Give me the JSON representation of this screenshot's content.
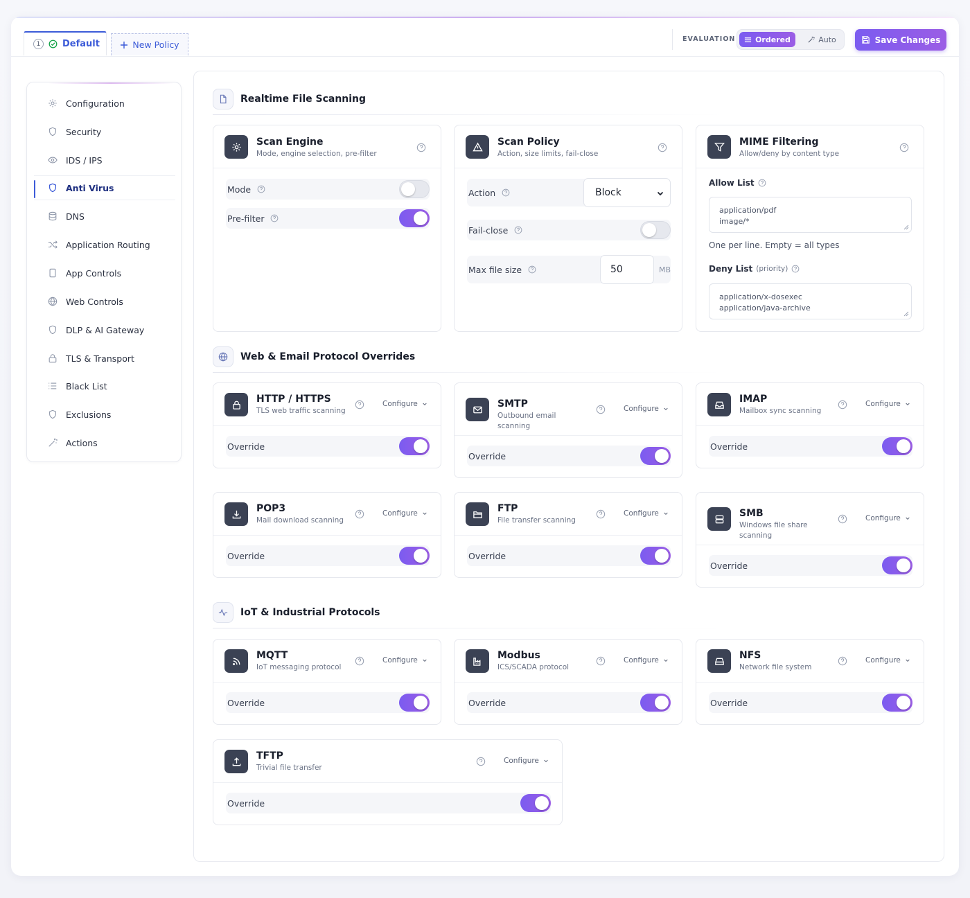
{
  "tabs": [
    {
      "number": "1",
      "label": "Default"
    },
    {
      "label": "New Policy"
    }
  ],
  "evaluation": {
    "label": "EVALUATION",
    "options": [
      "Ordered",
      "Auto"
    ],
    "selected": "Ordered"
  },
  "save_label": "Save Changes",
  "accent_color": "#7b5cf0",
  "sidebar": {
    "active": "Anti Virus",
    "items": [
      {
        "label": "Configuration",
        "icon": "gear-icon"
      },
      {
        "label": "Security",
        "icon": "shield-icon"
      },
      {
        "label": "IDS / IPS",
        "icon": "eye-icon"
      },
      {
        "label": "Anti Virus",
        "icon": "shield-icon"
      },
      {
        "label": "DNS",
        "icon": "database-icon"
      },
      {
        "label": "Application Routing",
        "icon": "shuffle-icon"
      },
      {
        "label": "App Controls",
        "icon": "tablet-icon"
      },
      {
        "label": "Web Controls",
        "icon": "globe-icon"
      },
      {
        "label": "DLP & AI Gateway",
        "icon": "shield-icon"
      },
      {
        "label": "TLS & Transport",
        "icon": "lock-icon"
      },
      {
        "label": "Black List",
        "icon": "list-icon"
      },
      {
        "label": "Exclusions",
        "icon": "shield-icon"
      },
      {
        "label": "Actions",
        "icon": "wand-icon"
      }
    ]
  },
  "sections": {
    "realtime": {
      "title": "Realtime File Scanning",
      "icon": "file-icon"
    },
    "web_email": {
      "title": "Web & Email Protocol Overrides",
      "icon": "globe-icon"
    },
    "iot": {
      "title": "IoT & Industrial Protocols",
      "icon": "activity-icon"
    }
  },
  "scan_engine": {
    "title": "Scan Engine",
    "subtitle": "Mode, engine selection, pre-filter",
    "rows": [
      {
        "label": "Mode",
        "enabled": false
      },
      {
        "label": "Pre-filter",
        "enabled": true
      }
    ]
  },
  "scan_policy": {
    "title": "Scan Policy",
    "subtitle": "Action, size limits, fail-close",
    "action_label": "Action",
    "action_value": "Block",
    "fail_close_label": "Fail-close",
    "fail_close_enabled": false,
    "max_size_label": "Max file size",
    "max_size_value": "50",
    "max_size_unit": "MB"
  },
  "mime": {
    "title": "MIME Filtering",
    "subtitle": "Allow/deny by content type",
    "allow_label": "Allow List",
    "allow_lines": [
      "application/pdf",
      "image/*"
    ],
    "allow_hint": "One per line. Empty = all types",
    "deny_label": "Deny List",
    "deny_note": "(priority)",
    "deny_lines": [
      "application/x-dosexec",
      "application/java-archive"
    ]
  },
  "configure_label": "Configure",
  "override_label": "Override",
  "protocols": [
    {
      "title": "HTTP / HTTPS",
      "subtitle": "TLS web traffic scanning",
      "icon": "lock-icon",
      "override": true
    },
    {
      "title": "SMTP",
      "subtitle": [
        "Outbound email",
        "scanning"
      ],
      "icon": "mail-icon",
      "override": true
    },
    {
      "title": "IMAP",
      "subtitle": "Mailbox sync scanning",
      "icon": "inbox-icon",
      "override": true
    },
    {
      "title": "POP3",
      "subtitle": "Mail download scanning",
      "icon": "download-icon",
      "override": true
    },
    {
      "title": "FTP",
      "subtitle": "File transfer scanning",
      "icon": "folder-icon",
      "override": true
    },
    {
      "title": "SMB",
      "subtitle": [
        "Windows file share",
        "scanning"
      ],
      "icon": "server-icon",
      "override": true
    },
    {
      "title": "MQTT",
      "subtitle": "IoT messaging protocol",
      "icon": "rss-icon",
      "override": true
    },
    {
      "title": "Modbus",
      "subtitle": "ICS/SCADA protocol",
      "icon": "factory-icon",
      "override": true
    },
    {
      "title": "NFS",
      "subtitle": "Network file system",
      "icon": "harddrive-icon",
      "override": true
    },
    {
      "title": "TFTP",
      "subtitle": "Trivial file transfer",
      "icon": "upload-icon",
      "override": true
    }
  ]
}
